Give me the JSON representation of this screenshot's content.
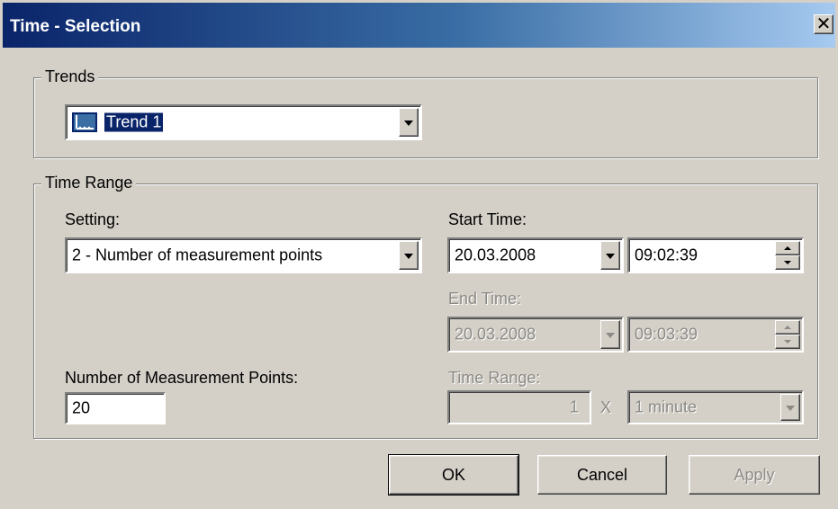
{
  "window": {
    "title": "Time - Selection"
  },
  "trends": {
    "group_label": "Trends",
    "selected": "Trend 1",
    "icon": "trend-chart-icon"
  },
  "time_range": {
    "group_label": "Time Range",
    "setting_label": "Setting:",
    "setting_value": "2 - Number of measurement points",
    "start_time_label": "Start Time:",
    "start_date": "20.03.2008",
    "start_time": "09:02:39",
    "end_time_label": "End Time:",
    "end_date": "20.03.2008",
    "end_time": "09:03:39",
    "num_points_label": "Number of Measurement Points:",
    "num_points": "20",
    "range_label": "Time Range:",
    "range_value": "1",
    "range_multiplier": "X",
    "range_unit": "1 minute"
  },
  "buttons": {
    "ok": "OK",
    "cancel": "Cancel",
    "apply": "Apply"
  },
  "colors": {
    "title_start": "#0a246a",
    "title_end": "#a6caf0",
    "face": "#d4d0c8",
    "selection": "#0a246a"
  }
}
